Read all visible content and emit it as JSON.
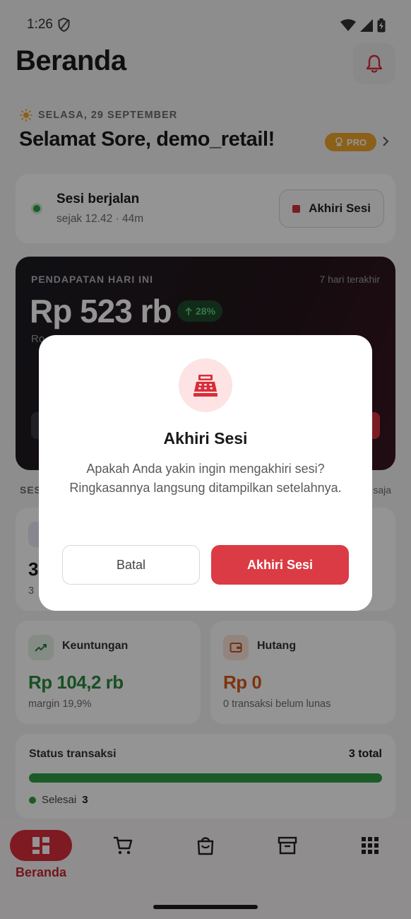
{
  "status_bar": {
    "time": "1:26"
  },
  "header": {
    "title": "Beranda"
  },
  "greeting": {
    "date": "SELASA, 29 SEPTEMBER",
    "text": "Selamat Sore, demo_retail!",
    "badge": "PRO"
  },
  "session": {
    "title": "Sesi berjalan",
    "subtitle": "sejak 12.42 · 44m",
    "end_label": "Akhiri Sesi"
  },
  "revenue": {
    "label": "PENDAPATAN HARI INI",
    "range": "7 hari terakhir",
    "value": "Rp 523 rb",
    "trend": "28%",
    "sub_visible": "Ro"
  },
  "section": {
    "label": "SES",
    "link": "saja"
  },
  "stats": {
    "top_left_value": "3",
    "top_left_sub": "3",
    "profit": {
      "title": "Keuntungan",
      "value": "Rp 104,2 rb",
      "sub": "margin 19,9%"
    },
    "debt": {
      "title": "Hutang",
      "value": "Rp 0",
      "sub": "0 transaksi belum lunas"
    }
  },
  "transaction_status": {
    "title": "Status transaksi",
    "total": "3 total",
    "legend_label": "Selesai",
    "legend_count": "3",
    "completed_fraction": 1.0
  },
  "bottom_nav": {
    "items": [
      {
        "label": "Beranda",
        "icon": "dashboard-icon",
        "active": true
      },
      {
        "icon": "cart-icon"
      },
      {
        "icon": "shopping-bag-icon"
      },
      {
        "icon": "archive-icon"
      },
      {
        "icon": "apps-grid-icon"
      }
    ]
  },
  "dialog": {
    "title": "Akhiri Sesi",
    "message": "Apakah Anda yakin ingin mengakhiri sesi? Ringkasannya langsung ditampilkan setelahnya.",
    "cancel_label": "Batal",
    "confirm_label": "Akhiri Sesi",
    "icon": "cash-register-icon"
  },
  "colors": {
    "accent_red": "#d92d3b",
    "success_green": "#2f9e44",
    "pro_orange": "#f0a52a",
    "debt_orange": "#d9591a"
  }
}
